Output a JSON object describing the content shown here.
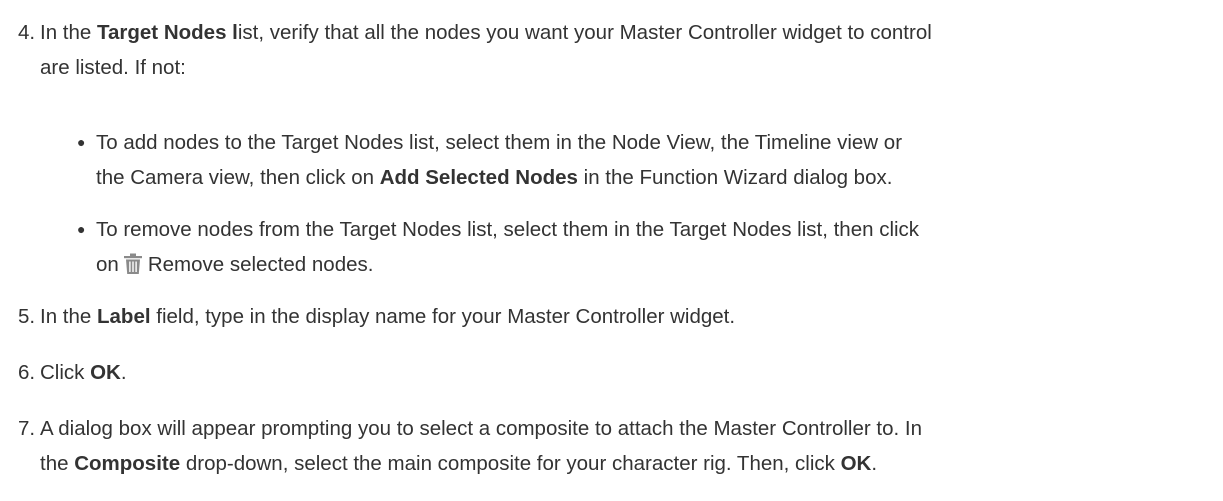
{
  "steps": [
    {
      "number": "4.",
      "prefix": "In the ",
      "bold": "Target Nodes l",
      "line1_rest": "ist, verify that all the nodes you want your Master Controller widget to control",
      "line2": "are listed. If not:"
    },
    {
      "number": "5.",
      "prefix": "In the ",
      "bold": "Label",
      "rest": " field, type in the display name for your Master Controller widget."
    },
    {
      "number": "6.",
      "prefix": "Click ",
      "bold": "OK",
      "rest": "."
    },
    {
      "number": "7.",
      "line1": "A dialog box will appear prompting you to select a composite to attach the Master Controller to. In",
      "line2_prefix": "the ",
      "line2_bold": "Composite",
      "line2_mid": " drop-down, select the main composite for your character rig. Then, click ",
      "line2_bold2": "OK",
      "line2_end": "."
    }
  ],
  "bullets": [
    {
      "line1": "To add nodes to the Target Nodes list, select them in the Node View, the Timeline view or",
      "line2_prefix": "the Camera view, then click on ",
      "line2_bold": "Add Selected Nodes",
      "line2_rest": " in the Function Wizard dialog box."
    },
    {
      "line1": "To remove nodes from the Target Nodes list, select them in the Target Nodes list, then click",
      "line2_prefix": "on",
      "icon": "trash-icon",
      "line2_rest": "Remove selected nodes."
    }
  ],
  "colors": {
    "text": "#333333",
    "icon": "#8a8a8a"
  }
}
